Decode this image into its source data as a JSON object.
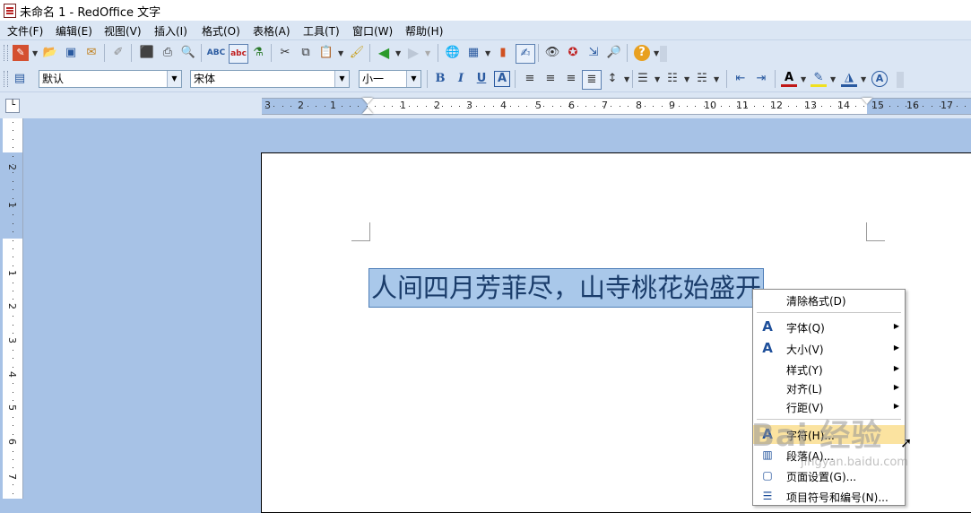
{
  "window": {
    "title": "未命名 1 - RedOffice 文字"
  },
  "menu": [
    "文件(F)",
    "编辑(E)",
    "视图(V)",
    "插入(I)",
    "格式(O)",
    "表格(A)",
    "工具(T)",
    "窗口(W)",
    "帮助(H)"
  ],
  "format_bar": {
    "style": "默认",
    "font": "宋体",
    "size": "小一"
  },
  "ruler": {
    "h_labels": [
      "3",
      "2",
      "1",
      "1",
      "2",
      "3",
      "4",
      "5",
      "6",
      "7",
      "8",
      "9",
      "10",
      "11",
      "12",
      "13",
      "14",
      "15",
      "16",
      "17"
    ],
    "v_labels": [
      "2",
      "1",
      "1",
      "2",
      "3",
      "4",
      "5",
      "6",
      "7"
    ]
  },
  "document": {
    "text": "人间四月芳菲尽，山寺桃花始盛开"
  },
  "context_menu": {
    "items": [
      {
        "label": "清除格式(D)",
        "icon": "",
        "submenu": false
      },
      {
        "label": "字体(Q)",
        "icon": "font-a-icon",
        "submenu": true
      },
      {
        "label": "大小(V)",
        "icon": "font-size-icon",
        "submenu": true
      },
      {
        "label": "样式(Y)",
        "icon": "",
        "submenu": true
      },
      {
        "label": "对齐(L)",
        "icon": "",
        "submenu": true
      },
      {
        "label": "行距(V)",
        "icon": "",
        "submenu": true
      },
      {
        "label": "字符(H)...",
        "icon": "character-icon",
        "submenu": false
      },
      {
        "label": "段落(A)...",
        "icon": "paragraph-icon",
        "submenu": false
      },
      {
        "label": "页面设置(G)...",
        "icon": "page-setup-icon",
        "submenu": false
      },
      {
        "label": "项目符号和编号(N)...",
        "icon": "bullets-icon",
        "submenu": false
      }
    ]
  },
  "watermark": {
    "main": "Bai 经验",
    "sub": "jingyan.baidu.com"
  }
}
